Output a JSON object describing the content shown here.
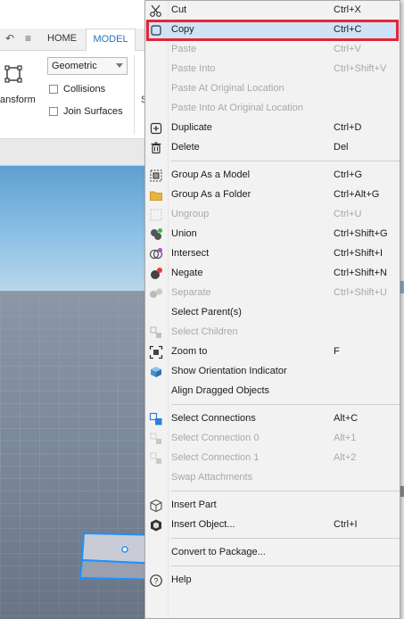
{
  "ribbon": {
    "tabs": [
      "HOME",
      "MODEL"
    ],
    "transform_label": "ansform",
    "collision_mode": "Geometric",
    "collisions_label": "Collisions",
    "join_surfaces_label": "Join Surfaces",
    "truncated_label": "S"
  },
  "menu": {
    "highlight_color": "#e32637",
    "items": [
      {
        "label": "Cut",
        "shortcut": "Ctrl+X",
        "icon": "scissors-icon",
        "enabled": true
      },
      {
        "label": "Copy",
        "shortcut": "Ctrl+C",
        "icon": "copy-icon",
        "enabled": true,
        "highlighted": true
      },
      {
        "label": "Paste",
        "shortcut": "Ctrl+V",
        "icon": "",
        "enabled": false
      },
      {
        "label": "Paste Into",
        "shortcut": "Ctrl+Shift+V",
        "icon": "",
        "enabled": false
      },
      {
        "label": "Paste At Original Location",
        "shortcut": "",
        "icon": "",
        "enabled": false
      },
      {
        "label": "Paste Into At Original Location",
        "shortcut": "",
        "icon": "",
        "enabled": false
      },
      {
        "label": "Duplicate",
        "shortcut": "Ctrl+D",
        "icon": "duplicate-icon",
        "enabled": true
      },
      {
        "label": "Delete",
        "shortcut": "Del",
        "icon": "trash-icon",
        "enabled": true
      },
      {
        "label": "Group As a Model",
        "shortcut": "Ctrl+G",
        "icon": "model-icon",
        "enabled": true
      },
      {
        "label": "Group As a Folder",
        "shortcut": "Ctrl+Alt+G",
        "icon": "folder-icon",
        "enabled": true
      },
      {
        "label": "Ungroup",
        "shortcut": "Ctrl+U",
        "icon": "ungroup-icon",
        "enabled": false
      },
      {
        "label": "Union",
        "shortcut": "Ctrl+Shift+G",
        "icon": "union-icon",
        "enabled": true
      },
      {
        "label": "Intersect",
        "shortcut": "Ctrl+Shift+I",
        "icon": "intersect-icon",
        "enabled": true
      },
      {
        "label": "Negate",
        "shortcut": "Ctrl+Shift+N",
        "icon": "negate-icon",
        "enabled": true
      },
      {
        "label": "Separate",
        "shortcut": "Ctrl+Shift+U",
        "icon": "separate-icon",
        "enabled": false
      },
      {
        "label": "Select Parent(s)",
        "shortcut": "",
        "icon": "",
        "enabled": true
      },
      {
        "label": "Select Children",
        "shortcut": "",
        "icon": "select-children-icon",
        "enabled": false
      },
      {
        "label": "Zoom to",
        "shortcut": "F",
        "icon": "zoom-to-icon",
        "enabled": true
      },
      {
        "label": "Show Orientation Indicator",
        "shortcut": "",
        "icon": "orientation-icon",
        "enabled": true
      },
      {
        "label": "Align Dragged Objects",
        "shortcut": "",
        "icon": "",
        "enabled": true
      },
      {
        "label": "Select Connections",
        "shortcut": "Alt+C",
        "icon": "select-connections-icon",
        "enabled": true
      },
      {
        "label": "Select Connection 0",
        "shortcut": "Alt+1",
        "icon": "connection-icon",
        "enabled": false
      },
      {
        "label": "Select Connection 1",
        "shortcut": "Alt+2",
        "icon": "connection-icon",
        "enabled": false
      },
      {
        "label": "Swap Attachments",
        "shortcut": "",
        "icon": "",
        "enabled": false
      },
      {
        "label": "Insert Part",
        "shortcut": "",
        "icon": "part-icon",
        "enabled": true
      },
      {
        "label": "Insert Object...",
        "shortcut": "Ctrl+I",
        "icon": "object-icon",
        "enabled": true
      },
      {
        "label": "Convert to Package...",
        "shortcut": "",
        "icon": "",
        "enabled": true
      },
      {
        "label": "Help",
        "shortcut": "",
        "icon": "help-icon",
        "enabled": true
      }
    ]
  }
}
